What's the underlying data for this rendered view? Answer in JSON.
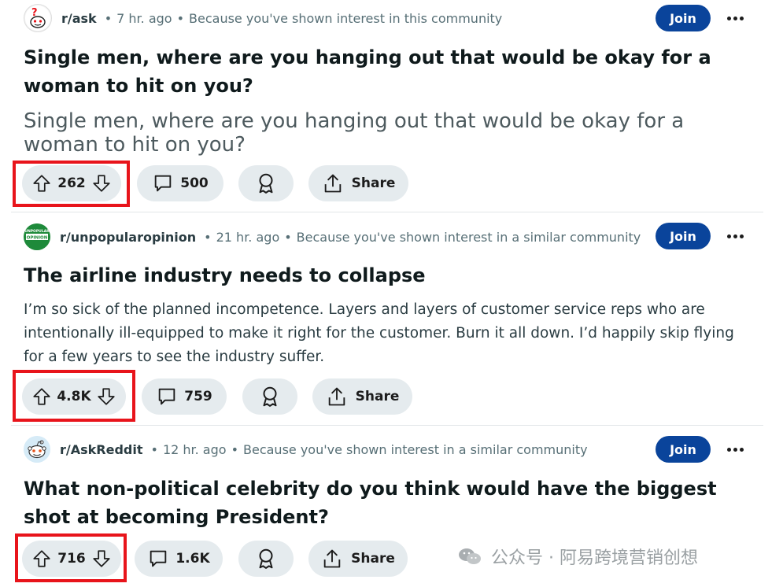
{
  "posts": [
    {
      "subreddit": "r/ask",
      "time": "7 hr. ago",
      "reason": "Because you've shown interest in this community",
      "join_label": "Join",
      "title": "Single men, where are you hanging out that would be okay for a woman to hit on you?",
      "body": "Single men, where are you hanging out that would be okay for a woman to hit on you?",
      "votes": "262",
      "comments": "500",
      "share_label": "Share"
    },
    {
      "subreddit": "r/unpopularopinion",
      "avatar_text": "UNPOPULAR OPINION",
      "time": "21 hr. ago",
      "reason": "Because you've shown interest in a similar community",
      "join_label": "Join",
      "title": "The airline industry needs to collapse",
      "body": "I’m so sick of the planned incompetence. Layers and layers of customer service reps who are intentionally ill-equipped to make it right for the customer. Burn it all down. I’d happily skip flying for a few years to see the industry suffer.",
      "votes": "4.8K",
      "comments": "759",
      "share_label": "Share"
    },
    {
      "subreddit": "r/AskReddit",
      "time": "12 hr. ago",
      "reason": "Because you've shown interest in a similar community",
      "join_label": "Join",
      "title": "What non-political celebrity do you think would have the biggest shot at becoming President?",
      "votes": "716",
      "comments": "1.6K",
      "share_label": "Share"
    }
  ],
  "separator": "•",
  "watermark": "公众号 · 阿易跨境营销创想",
  "colors": {
    "join_bg": "#0a449b",
    "pill_bg": "#e5ebee",
    "highlight": "#e8141b",
    "unpopular_green": "#1e8a3a"
  }
}
